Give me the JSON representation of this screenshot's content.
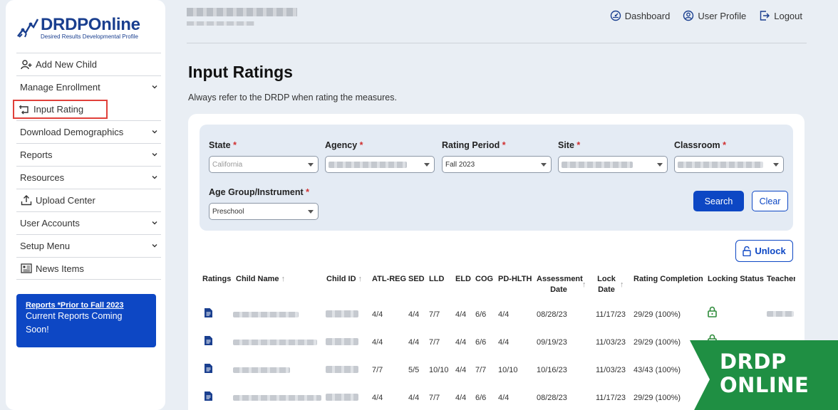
{
  "logo": {
    "title": "DRDPOnline",
    "subtitle": "Desired Results Developmental Profile"
  },
  "sidebar": {
    "items": [
      {
        "label": "Add New Child"
      },
      {
        "label": "Manage Enrollment"
      },
      {
        "label": "Input Rating"
      },
      {
        "label": "Download Demographics"
      },
      {
        "label": "Reports"
      },
      {
        "label": "Resources"
      },
      {
        "label": "Upload Center"
      },
      {
        "label": "User Accounts"
      },
      {
        "label": "Setup Menu"
      },
      {
        "label": "News Items"
      }
    ],
    "promo": {
      "link": "Reports *Prior to Fall 2023",
      "text": "Current Reports Coming Soon!"
    }
  },
  "topnav": {
    "dashboard": "Dashboard",
    "profile": "User Profile",
    "logout": "Logout"
  },
  "page": {
    "title": "Input Ratings",
    "subtitle": "Always refer to the DRDP when rating the measures."
  },
  "filters": {
    "state": {
      "label": "State",
      "value": "California"
    },
    "agency": {
      "label": "Agency"
    },
    "rating_period": {
      "label": "Rating Period",
      "value": "Fall 2023"
    },
    "site": {
      "label": "Site"
    },
    "classroom": {
      "label": "Classroom"
    },
    "age_group": {
      "label": "Age Group/Instrument",
      "value": "Preschool"
    },
    "required_mark": "*",
    "search": "Search",
    "clear": "Clear"
  },
  "unlock": "Unlock",
  "table": {
    "headers": {
      "ratings": "Ratings",
      "child_name": "Child Name",
      "child_id": "Child ID",
      "atl_reg": "ATL-REG",
      "sed": "SED",
      "lld": "LLD",
      "eld": "ELD",
      "cog": "COG",
      "pd_hlth": "PD-HLTH",
      "assessment_date_1": "Assessment",
      "assessment_date_2": "Date",
      "lock_date_1": "Lock",
      "lock_date_2": "Date",
      "rating_completion": "Rating Completion",
      "locking_status": "Locking Status",
      "teacher": "Teacher"
    },
    "rows": [
      {
        "atl": "4/4",
        "sed": "4/4",
        "lld": "7/7",
        "eld": "4/4",
        "cog": "6/6",
        "pd": "4/4",
        "assess": "08/28/23",
        "lock": "11/17/23",
        "completion": "29/29 (100%)"
      },
      {
        "atl": "4/4",
        "sed": "4/4",
        "lld": "7/7",
        "eld": "4/4",
        "cog": "6/6",
        "pd": "4/4",
        "assess": "09/19/23",
        "lock": "11/03/23",
        "completion": "29/29 (100%)"
      },
      {
        "atl": "7/7",
        "sed": "5/5",
        "lld": "10/10",
        "eld": "4/4",
        "cog": "7/7",
        "pd": "10/10",
        "assess": "10/16/23",
        "lock": "11/03/23",
        "completion": "43/43 (100%)"
      },
      {
        "atl": "4/4",
        "sed": "4/4",
        "lld": "7/7",
        "eld": "4/4",
        "cog": "6/6",
        "pd": "4/4",
        "assess": "08/28/23",
        "lock": "11/17/23",
        "completion": "29/29 (100%)"
      }
    ]
  },
  "badge": {
    "line1": "DRDP",
    "line2": "ONLINE"
  },
  "colors": {
    "brand_blue": "#0d47c4",
    "logo_blue": "#1a3f8f",
    "badge_green": "#1f8f43",
    "highlight_red": "#e0403a",
    "lock_green": "#2e8b3a"
  }
}
